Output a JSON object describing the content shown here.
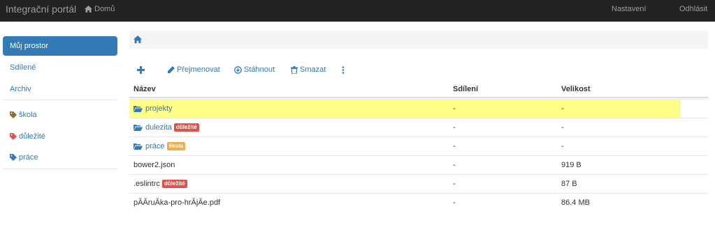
{
  "navbar": {
    "brand": "Integrační portál",
    "home_label": "Domů",
    "settings_label": "Nastavení",
    "logout_label": "Odhlásit"
  },
  "sidebar": {
    "items": [
      {
        "label": "Můj prostor"
      },
      {
        "label": "Sdílené"
      },
      {
        "label": "Archiv"
      }
    ],
    "tags": [
      {
        "label": "škola",
        "color": "#8a6d3b"
      },
      {
        "label": "důležité",
        "color": "#d9534f"
      },
      {
        "label": "práce",
        "color": "#337ab7"
      }
    ]
  },
  "toolbar": {
    "rename_label": "Přejmenovat",
    "download_label": "Stáhnout",
    "delete_label": "Smazat"
  },
  "table": {
    "columns": [
      "Název",
      "Sdílení",
      "Velikost"
    ],
    "rows": [
      {
        "name": "projekty",
        "badge": "",
        "shared": "-",
        "size": "-"
      },
      {
        "name": "dulezita",
        "badge": "důležité",
        "shared": "-",
        "size": "-"
      },
      {
        "name": "práce",
        "badge": "škola",
        "shared": "-",
        "size": "-"
      },
      {
        "name": "bower2.json",
        "badge": "",
        "shared": "-",
        "size": "919 B"
      },
      {
        "name": ".eslintrc",
        "badge": "důležité",
        "shared": "-",
        "size": "87 B"
      },
      {
        "name": "pĂĂruĂka-pro-hrĂjĂe.pdf",
        "badge": "",
        "shared": "-",
        "size": "86.4 MB"
      }
    ]
  },
  "colors": {
    "accent": "#337ab7",
    "danger": "#d9534f",
    "warning": "#f0ad4e",
    "highlight": "#ffff88",
    "navbar": "#222222"
  }
}
